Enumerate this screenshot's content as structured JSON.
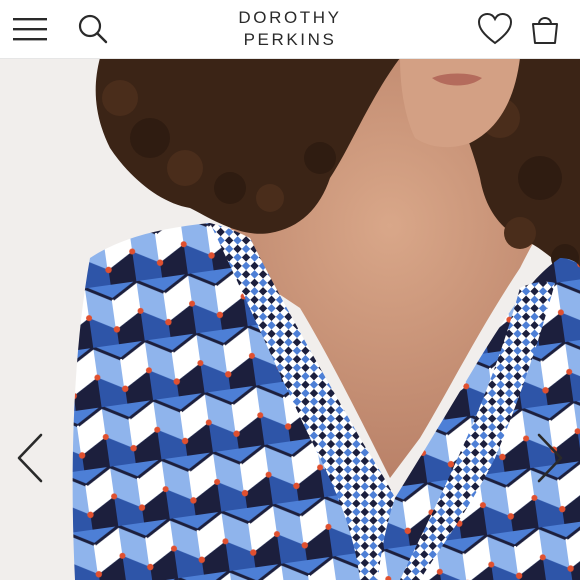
{
  "header": {
    "brand_line1": "DOROTHY",
    "brand_line2": "PERKINS",
    "menu_icon": "hamburger-menu-icon",
    "search_icon": "search-icon",
    "wishlist_icon": "heart-icon",
    "bag_icon": "shopping-bag-icon"
  },
  "gallery": {
    "prev_icon": "chevron-left-icon",
    "next_icon": "chevron-right-icon"
  },
  "colors": {
    "text": "#2a2a2a",
    "print_blue": "#4d7fd6",
    "print_light_blue": "#8fb4ec",
    "print_navy": "#1c1f3d",
    "print_accent": "#e0502f",
    "background": "#f1eeec",
    "skin": "#c48f74",
    "hair": "#3b2416"
  }
}
